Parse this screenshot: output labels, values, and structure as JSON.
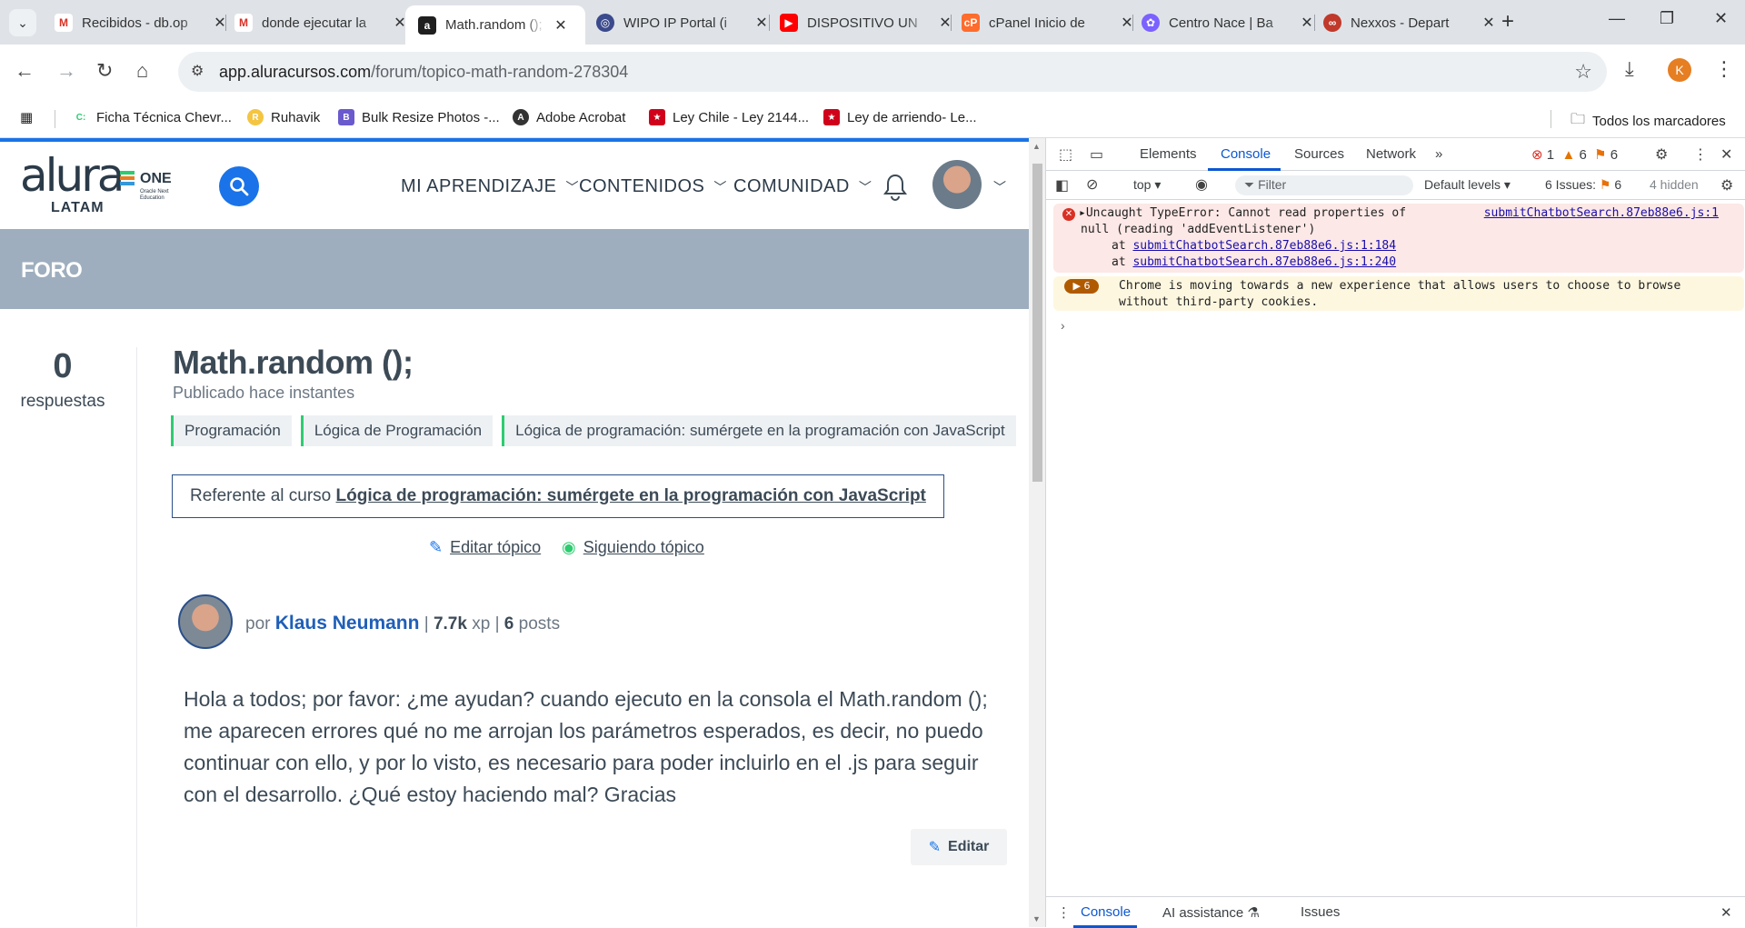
{
  "browser": {
    "tabs": [
      {
        "title": "Recibidos - db.op",
        "icon": "gmail-icon",
        "color": "#d93025"
      },
      {
        "title": "donde ejecutar la",
        "icon": "gmail-icon",
        "color": "#d93025"
      },
      {
        "title": "Math.random ();",
        "icon": "alura-icon",
        "color": "#1f1f1f"
      },
      {
        "title": "WIPO IP Portal (i",
        "icon": "globe-icon",
        "color": "#3b4a8c"
      },
      {
        "title": "DISPOSITIVO UN",
        "icon": "youtube-icon",
        "color": "#ff0000"
      },
      {
        "title": "cPanel Inicio de",
        "icon": "cpanel-icon",
        "color": "#ff6c2c"
      },
      {
        "title": "Centro Nace | Ba",
        "icon": "nace-icon",
        "color": "#7b61ff"
      },
      {
        "title": "Nexxos - Depart",
        "icon": "nexxos-icon",
        "color": "#c0392b"
      }
    ],
    "url_host": "app.aluracursos.com",
    "url_path": "/forum/topico-math-random-278304",
    "profile_initial": "K",
    "bookmarks": [
      {
        "label": "Ficha Técnica Chevr...",
        "icon": "chevrolet-icon"
      },
      {
        "label": "Ruhavik",
        "icon": "ruhavik-icon"
      },
      {
        "label": "Bulk Resize Photos -...",
        "icon": "bulk-resize-icon"
      },
      {
        "label": "Adobe Acrobat",
        "icon": "acrobat-icon"
      },
      {
        "label": "Ley Chile - Ley 2144...",
        "icon": "ley-chile-icon"
      },
      {
        "label": "Ley de arriendo- Le...",
        "icon": "ley-chile-icon"
      }
    ],
    "all_bookmarks": "Todos los marcadores"
  },
  "site": {
    "logo_text": "alura",
    "logo_region": "LATAM",
    "logo_one": "ONE",
    "logo_one_sub": "Oracle Next Education",
    "nav": [
      {
        "label": "MI APRENDIZAJE"
      },
      {
        "label": "CONTENIDOS"
      },
      {
        "label": "COMUNIDAD"
      }
    ],
    "section_title": "FORO"
  },
  "topic": {
    "answers_count": "0",
    "answers_label": "respuestas",
    "title": "Math.random ();",
    "published": "Publicado hace instantes",
    "tags": [
      "Programación",
      "Lógica de Programación",
      "Lógica de programación: sumérgete en la programación con JavaScript"
    ],
    "course_prefix": "Referente al curso",
    "course_name": "Lógica de programación: sumérgete en la programación con JavaScript",
    "edit_topic": "Editar tópico",
    "following_topic": "Siguiendo tópico",
    "author_prefix": "por",
    "author_name": "Klaus Neumann",
    "author_xp_value": "7.7k",
    "author_xp_unit": "xp",
    "author_posts_value": "6",
    "author_posts_unit": "posts",
    "body": "Hola a todos; por favor: ¿me ayudan? cuando ejecuto en la consola el Math.random (); me aparecen errores qué no me arrojan los parámetros esperados, es decir, no puedo continuar con ello, y por lo visto, es necesario para poder incluirlo en el .js para seguir con el desarrollo. ¿Qué estoy haciendo mal? Gracias",
    "edit_button": "Editar"
  },
  "devtools": {
    "tabs": [
      "Elements",
      "Console",
      "Sources",
      "Network"
    ],
    "active_tab": "Console",
    "errors_count": "1",
    "warnings_count": "6",
    "issues_count": "6",
    "context": "top",
    "filter_placeholder": "Filter",
    "levels": "Default levels",
    "issues_label": "6 Issues:",
    "issues_badge": "6",
    "hidden": "4 hidden",
    "error": {
      "line1": "Uncaught TypeError: Cannot read properties of",
      "line2": "null (reading 'addEventListener')",
      "at1_prefix": "at",
      "at1_link": "submitChatbotSearch.87eb88e6.js:1:184",
      "at2_prefix": "at",
      "at2_link": "submitChatbotSearch.87eb88e6.js:1:240",
      "source": "submitChatbotSearch.87eb88e6.js:1"
    },
    "warning": {
      "count": "6",
      "text": "Chrome is moving towards a new experience that allows users to choose to browse without third-party cookies."
    },
    "drawer_tabs": [
      "Console",
      "AI assistance",
      "Issues"
    ]
  },
  "colors": {
    "accent": "#1a73e8",
    "foro_band": "#9eaebe",
    "author_link": "#1f5fb8",
    "tag_border": "#2ecc71",
    "error_bg": "#fce8e6",
    "warning_bg": "#fef7e0"
  }
}
